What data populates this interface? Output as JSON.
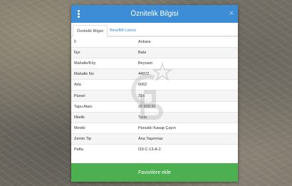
{
  "modal": {
    "title": "Öznitelik Bilgisi",
    "close_glyph": "×",
    "menu_icon": "kebab-menu-icon"
  },
  "tabs": [
    {
      "label": "Öznitelik Bilgisi",
      "active": true
    },
    {
      "label": "Bina/BB Listesi",
      "active": false
    }
  ],
  "attributes": [
    {
      "key": "İl",
      "value": "Ankara"
    },
    {
      "key": "İlçe",
      "value": "Bala"
    },
    {
      "key": "Mahalle/Köy",
      "value": "Beynam"
    },
    {
      "key": "Mahalle No",
      "value": "44972"
    },
    {
      "key": "Ada",
      "value": "6062"
    },
    {
      "key": "Parsel",
      "value": "316"
    },
    {
      "key": "Tapu Alanı",
      "value": "28.828,96"
    },
    {
      "key": "Nitelik",
      "value": "Tarla"
    },
    {
      "key": "Mevkii",
      "value": "Parsaklı Kasap Çayırı"
    },
    {
      "key": "Zemin Tip",
      "value": "Ana Taşınmaz"
    },
    {
      "key": "Pafta",
      "value": "I29-C-13-A-2"
    }
  ],
  "footer": {
    "button_label": "Favorilere ekle"
  },
  "colors": {
    "header": "#3c8dd5",
    "footer": "#4caf50"
  }
}
